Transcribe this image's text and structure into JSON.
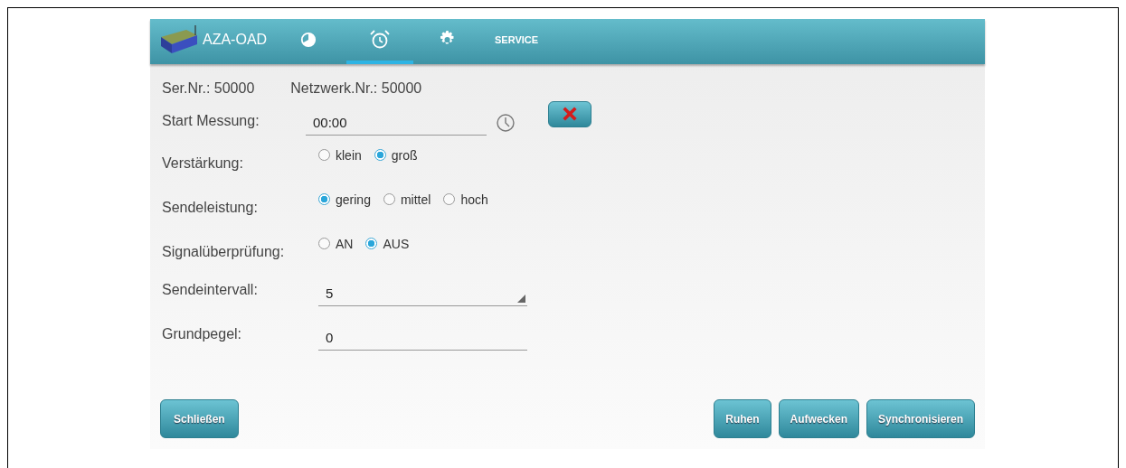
{
  "tabs": [
    {
      "kind": "logo",
      "label": "AZA-OAD",
      "selected": false
    },
    {
      "kind": "chart",
      "selected": false
    },
    {
      "kind": "alarm",
      "selected": true
    },
    {
      "kind": "settings",
      "selected": false
    },
    {
      "kind": "text",
      "label": "SERVICE",
      "selected": false
    }
  ],
  "info": [
    {
      "label": "Ser.Nr.:",
      "value": "50000"
    },
    {
      "label": "Netzwerk.Nr.:",
      "value": "50000"
    }
  ],
  "start_measurement": {
    "label": "Start Messung:",
    "value": "00:00"
  },
  "radio_groups": [
    {
      "label": "Verstärkung:",
      "options": [
        {
          "label": "klein",
          "selected": false
        },
        {
          "label": "groß",
          "selected": true
        }
      ]
    },
    {
      "label": "Sendeleistung:",
      "options": [
        {
          "label": "gering",
          "selected": true
        },
        {
          "label": "mittel",
          "selected": false
        },
        {
          "label": "hoch",
          "selected": false
        }
      ]
    },
    {
      "label": "Signalüberprüfung:",
      "options": [
        {
          "label": "AN",
          "selected": false
        },
        {
          "label": "AUS",
          "selected": true
        }
      ]
    }
  ],
  "fields": [
    {
      "kind": "select",
      "label": "Sendeintervall:",
      "value": "5"
    },
    {
      "kind": "input",
      "label": "Grundpegel:",
      "value": "0"
    }
  ],
  "buttons_left": [
    "Schließen"
  ],
  "buttons_right": [
    "Ruhen",
    "Aufwecken",
    "Synchronisieren"
  ]
}
